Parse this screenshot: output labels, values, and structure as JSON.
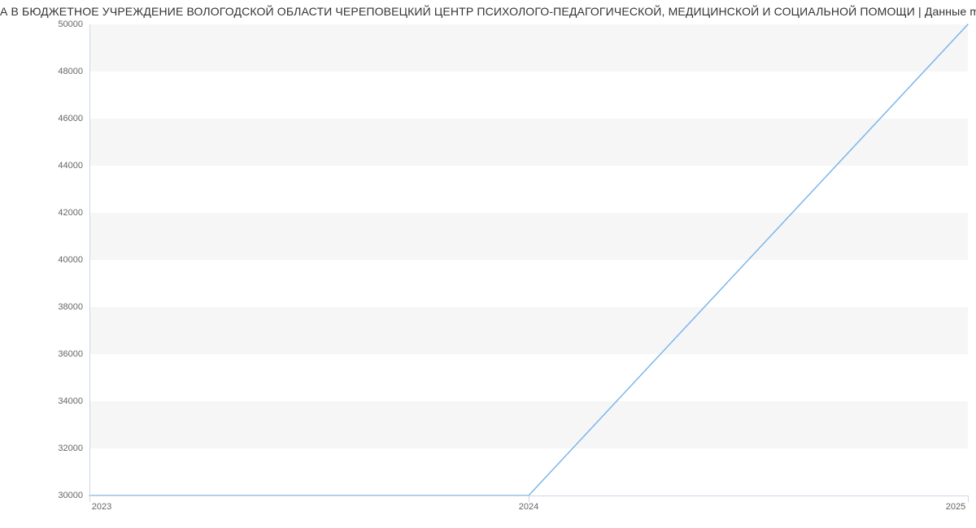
{
  "chart_data": {
    "type": "line",
    "title": "А В БЮДЖЕТНОЕ УЧРЕЖДЕНИЕ ВОЛОГОДСКОЙ ОБЛАСТИ ЧЕРЕПОВЕЦКИЙ ЦЕНТР ПСИХОЛОГО-ПЕДАГОГИЧЕСКОЙ, МЕДИЦИНСКОЙ И СОЦИАЛЬНОЙ ПОМОЩИ | Данные mn",
    "xlabel": "",
    "ylabel": "",
    "x": [
      "2023",
      "2024",
      "2025"
    ],
    "values": [
      30000,
      30000,
      50000
    ],
    "ylim": [
      30000,
      50000
    ],
    "y_ticks": [
      30000,
      32000,
      34000,
      36000,
      38000,
      40000,
      42000,
      44000,
      46000,
      48000,
      50000
    ],
    "series_color": "#7cb5ec"
  }
}
